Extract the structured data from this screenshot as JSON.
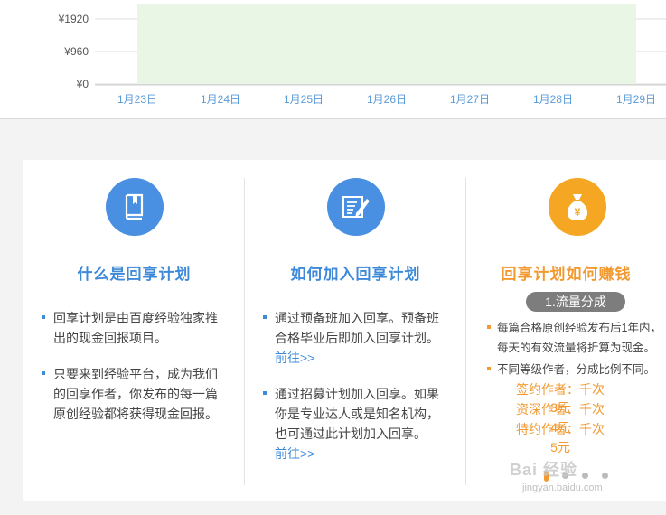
{
  "chart_data": {
    "type": "area",
    "y_ticks": [
      "¥1920",
      "¥960",
      "¥0"
    ],
    "y_tick_values": [
      1920,
      960,
      0
    ],
    "categories": [
      "1月23日",
      "1月24日",
      "1月25日",
      "1月26日",
      "1月27日",
      "1月28日",
      "1月29日"
    ],
    "ylim": [
      0,
      1920
    ],
    "fill_color": "#e9f6e6",
    "grid": true
  },
  "columns": [
    {
      "title": "什么是回享计划",
      "icon": "book-icon",
      "bullets": [
        [
          "回享计划是由百度经验独家推",
          "出的现金回报项目。"
        ],
        [
          "只要来到经验平台，成为我们",
          "的回享作者，你发布的每一篇",
          "原创经验都将获得现金回报。"
        ]
      ]
    },
    {
      "title": "如何加入回享计划",
      "icon": "document-pencil-icon",
      "bullets": [
        [
          "通过预备班加入回享。预备班",
          "合格毕业后即加入回享计划。"
        ],
        [
          "通过招募计划加入回享。如果",
          "你是专业达人或是知名机构，",
          "也可通过此计划加入回享。"
        ]
      ],
      "link": "前往>>"
    },
    {
      "title": "回享计划如何赚钱",
      "icon": "money-bag-icon",
      "pill": "1.流量分成",
      "bullets": [
        [
          "每篇合格原创经验发布后1年内，",
          "每天的有效流量将折算为现金。"
        ],
        [
          "不同等级作者，分成比例不同。"
        ]
      ],
      "tiers": [
        "签约作者：千次3元",
        "资深作者：千次4元",
        "特约作者：千次5元"
      ]
    }
  ],
  "watermark": {
    "main": "Bai 经验",
    "sub": "jingyan.baidu.com"
  },
  "colors": {
    "blue": "#3e8ad9",
    "orange": "#f29a31",
    "icon_blue": "#4a90e2",
    "icon_orange": "#f5a623"
  }
}
